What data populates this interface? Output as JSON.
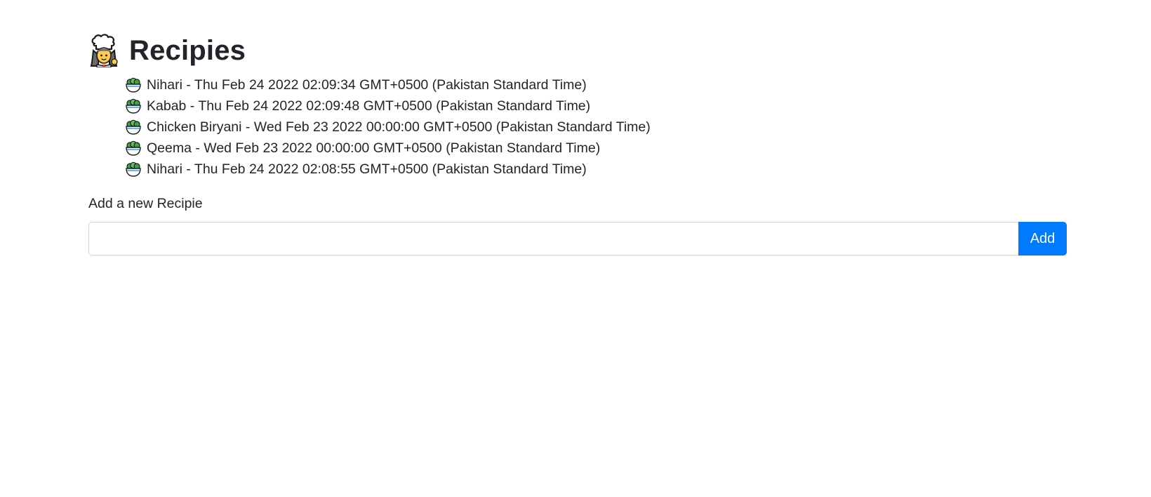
{
  "header": {
    "icon": "woman-cook-icon",
    "title": "Recipies"
  },
  "recipes": [
    {
      "icon": "green-salad-icon",
      "text": "Nihari - Thu Feb 24 2022 02:09:34 GMT+0500 (Pakistan Standard Time)"
    },
    {
      "icon": "green-salad-icon",
      "text": "Kabab - Thu Feb 24 2022 02:09:48 GMT+0500 (Pakistan Standard Time)"
    },
    {
      "icon": "green-salad-icon",
      "text": "Chicken Biryani - Wed Feb 23 2022 00:00:00 GMT+0500 (Pakistan Standard Time)"
    },
    {
      "icon": "green-salad-icon",
      "text": "Qeema - Wed Feb 23 2022 00:00:00 GMT+0500 (Pakistan Standard Time)"
    },
    {
      "icon": "green-salad-icon",
      "text": "Nihari - Thu Feb 24 2022 02:08:55 GMT+0500 (Pakistan Standard Time)"
    }
  ],
  "form": {
    "label": "Add a new Recipie",
    "input_value": "",
    "add_label": "Add"
  },
  "colors": {
    "primary": "#007bff",
    "text": "#212529",
    "input_border": "#ced4da"
  }
}
